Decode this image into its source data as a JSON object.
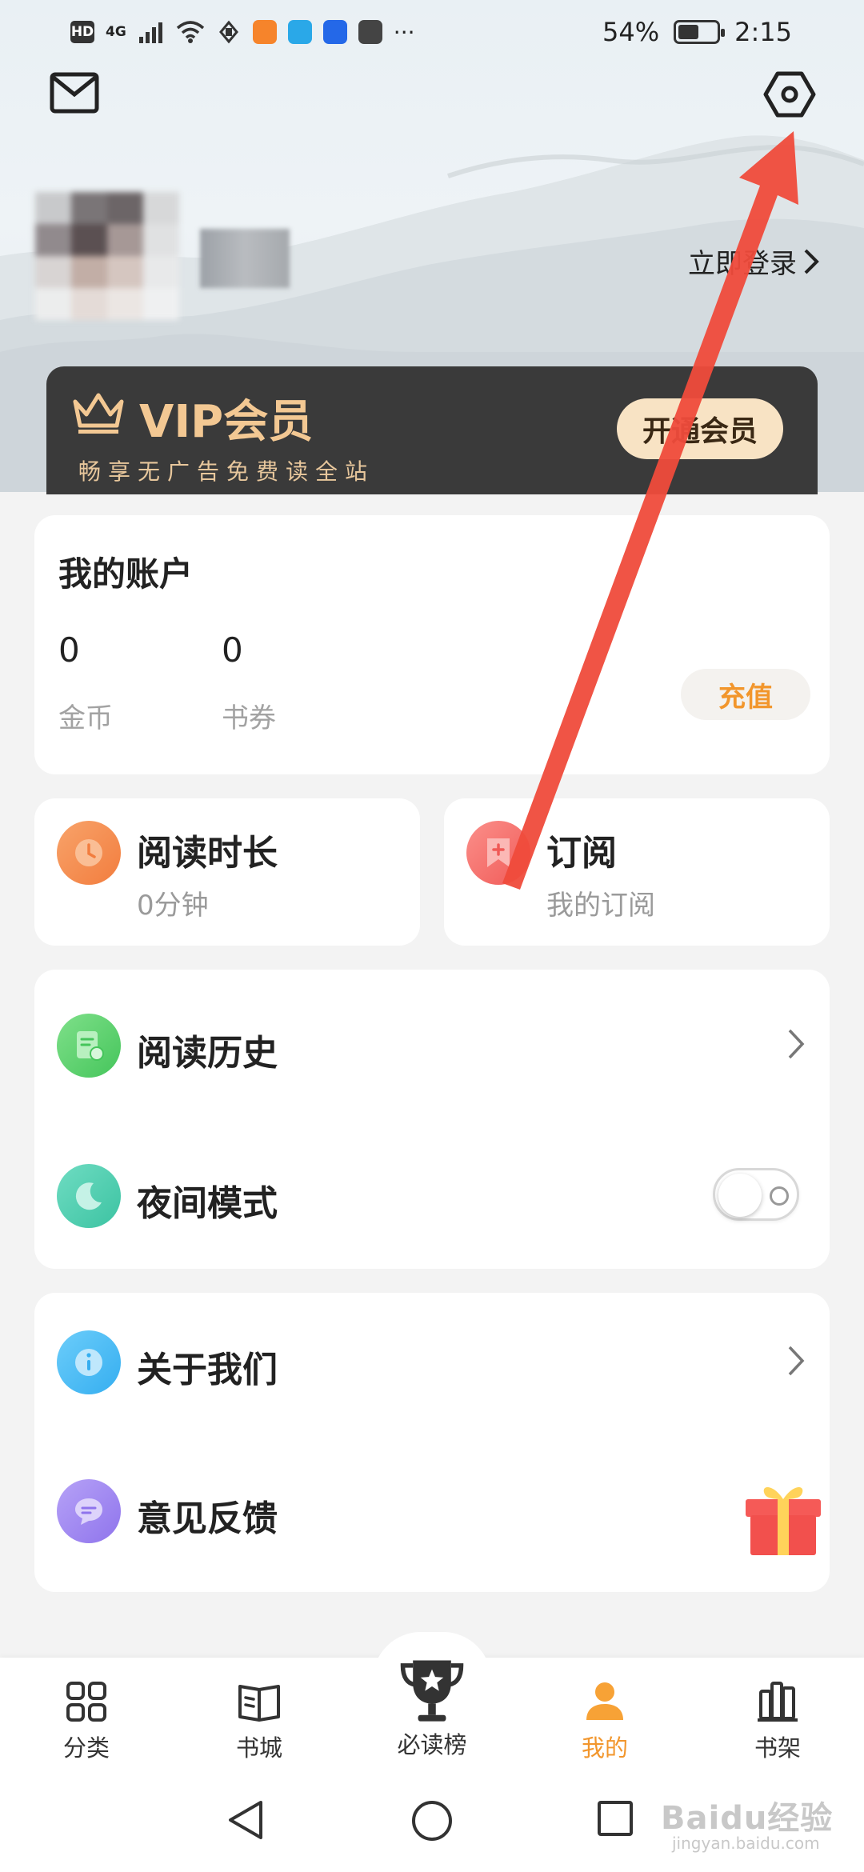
{
  "status_bar": {
    "hd": "HD",
    "network": "4G",
    "battery_percent_text": "54%",
    "battery_level": 0.54,
    "time": "2:15",
    "more": "···"
  },
  "header": {
    "login_label": "立即登录"
  },
  "vip": {
    "title": "VIP会员",
    "subtitle": "畅享无广告免费读全站",
    "button": "开通会员",
    "accent": "#f3c893"
  },
  "account": {
    "title": "我的账户",
    "coins_value": "0",
    "coins_label": "金币",
    "vouchers_value": "0",
    "vouchers_label": "书券",
    "recharge": "充值"
  },
  "reading_time": {
    "title": "阅读时长",
    "value": "0分钟"
  },
  "subscription": {
    "title": "订阅",
    "sub": "我的订阅"
  },
  "menu1": {
    "history": "阅读历史",
    "night_mode": "夜间模式",
    "night_mode_on": false
  },
  "menu2": {
    "about": "关于我们",
    "feedback": "意见反馈"
  },
  "bottom_nav": {
    "tabs": [
      {
        "label": "分类",
        "icon": "grid-icon"
      },
      {
        "label": "书城",
        "icon": "book-open-icon"
      },
      {
        "label": "必读榜",
        "icon": "trophy-icon"
      },
      {
        "label": "我的",
        "icon": "person-icon",
        "active": true
      },
      {
        "label": "书架",
        "icon": "bookshelf-icon"
      }
    ],
    "active_color": "#f2962c"
  },
  "watermark": {
    "text": "Baidu经验",
    "url": "jingyan.baidu.com"
  }
}
